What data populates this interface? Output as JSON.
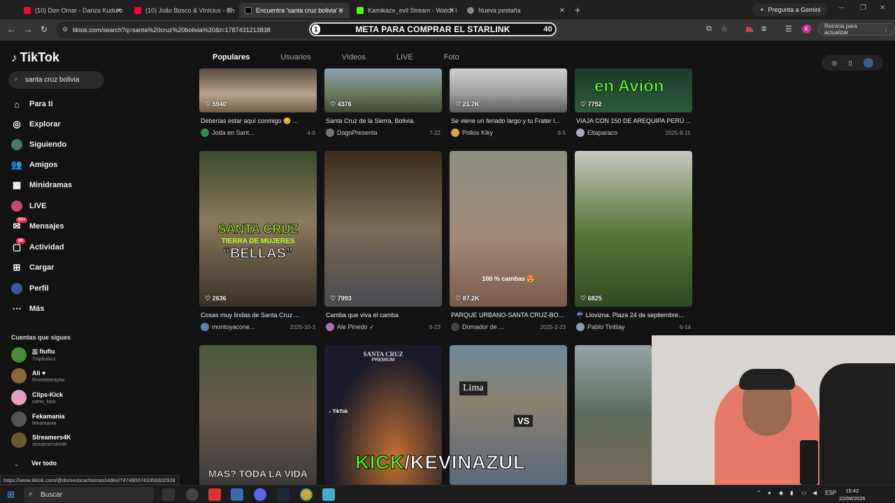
{
  "browser": {
    "tabs": [
      {
        "title": "(10) Don Omar - Danza Kuduro",
        "color": "#ff0033"
      },
      {
        "title": "(10) João Bosco & Vinícius - Ch",
        "color": "#ff0033"
      },
      {
        "title": "Encuentra 'santa cruz bolivia' e",
        "color": "#000000"
      },
      {
        "title": "Kamikaze_evil Stream - Watch l",
        "color": "#53fc18"
      },
      {
        "title": "Nueva pestaña",
        "color": "#888888"
      }
    ],
    "new_tab_symbol": "+",
    "gemini_label": "Pregunta a Gemini",
    "url": "tiktok.com/search?q=santa%20cruz%20bolivia%20&t=1787431213838",
    "reload_button": "Reinicia para actualizar",
    "profile_letter": "K",
    "ext_badge": "5"
  },
  "overlay": {
    "left": "1",
    "text": "META PARA COMPRAR EL STARLINK",
    "right": "40"
  },
  "tiktok": {
    "logo": "TikTok",
    "search_value": "santa cruz bolivia",
    "nav": [
      {
        "label": "Para ti",
        "icon": "home-icon"
      },
      {
        "label": "Explorar",
        "icon": "compass-icon"
      },
      {
        "label": "Siguiendo",
        "icon": "following-avatar-icon"
      },
      {
        "label": "Amigos",
        "icon": "friends-icon"
      },
      {
        "label": "Minidramas",
        "icon": "minidramas-icon"
      },
      {
        "label": "LIVE",
        "icon": "live-icon"
      },
      {
        "label": "Mensajes",
        "icon": "messages-icon",
        "badge": "99+"
      },
      {
        "label": "Actividad",
        "icon": "activity-icon",
        "badge": "89"
      },
      {
        "label": "Cargar",
        "icon": "upload-icon"
      },
      {
        "label": "Perfil",
        "icon": "profile-icon"
      },
      {
        "label": "Más",
        "icon": "more-icon"
      }
    ],
    "following_title": "Cuentas que sigues",
    "following": [
      {
        "name": "🇸 fiufiu",
        "handle": "7vipfiufiu1",
        "color": "#4a8b3a"
      },
      {
        "name": "Ali ♥",
        "handle": "threetwentytw",
        "color": "#8a6a3a"
      },
      {
        "name": "Clips-Kick",
        "handle": "corto_kick",
        "color": "#e0a0c0"
      },
      {
        "name": "Fekamania",
        "handle": "fekamania",
        "color": "#555555"
      },
      {
        "name": "Streamers4K",
        "handle": "streamersen4k",
        "color": "#6b5a2a"
      }
    ],
    "see_all": "Ver todo",
    "search_tabs": [
      "Populares",
      "Usuarios",
      "Vídeos",
      "LIVE",
      "Foto"
    ],
    "rows": [
      [
        {
          "likes": "5940",
          "caption": "Deberías estar aquí conmigo 😊 ...",
          "author": "Joda en Sant...",
          "date": "4-8"
        },
        {
          "likes": "4376",
          "caption": "Santa Cruz de la Sierra, Bolivia.",
          "author": "DagoPresenta",
          "date": "7-22"
        },
        {
          "likes": "21.7K",
          "caption": "Se viene un feriado largo y tu Frater l...",
          "author": "Pollos Kiky",
          "date": "8-5"
        },
        {
          "likes": "7752",
          "caption": "VIAJA CON 150 DE AREQUIPA PERÚ ...",
          "author": "Eltaparaco",
          "date": "2025-8-15",
          "overlay": "en Avión"
        }
      ],
      [
        {
          "likes": "2636",
          "caption": "Cosas muy lindas de Santa Cruz ...",
          "author": "montoyacone...",
          "date": "2025-10-3",
          "overlay1": "SANTA CRUZ",
          "overlay2": "TIERRA DE MUJERES",
          "overlay3": "“BELLAS”"
        },
        {
          "likes": "7993",
          "caption": "Camba que viva el camba",
          "author": "Ale Pinedo ✓",
          "date": "6-23"
        },
        {
          "likes": "87.2K",
          "caption": "PARQUE URBANO-SANTA CRUZ-BO...",
          "author": "Domador de ...",
          "date": "2025-2-23",
          "overlay": "100 % cambas 😍"
        },
        {
          "likes": "6825",
          "caption": "☔ Llovizna. Plaza 24 de septiembre...",
          "author": "Pablo Tintilay",
          "date": "6-14"
        }
      ],
      [
        {
          "overlay": "MÁS? TODA LA VIDA"
        },
        {
          "overlay": "SANTA CRUZ",
          "overlay_sub": "PREMIUM",
          "overlay_tag": "♪ TikTok"
        },
        {
          "overlay": "Lima",
          "overlay_vs": "VS"
        },
        {
          "overlay": ""
        }
      ]
    ]
  },
  "stream_overlay": {
    "kick_prefix": "KICK",
    "kick_rest": "/KEVINAZUL"
  },
  "status_link": "https://www.tiktok.com/@domesticachomas/video/7474800743359302928",
  "taskbar": {
    "search_placeholder": "Buscar",
    "lang": "ESP",
    "time": "15:42",
    "date": "22/08/2026"
  }
}
